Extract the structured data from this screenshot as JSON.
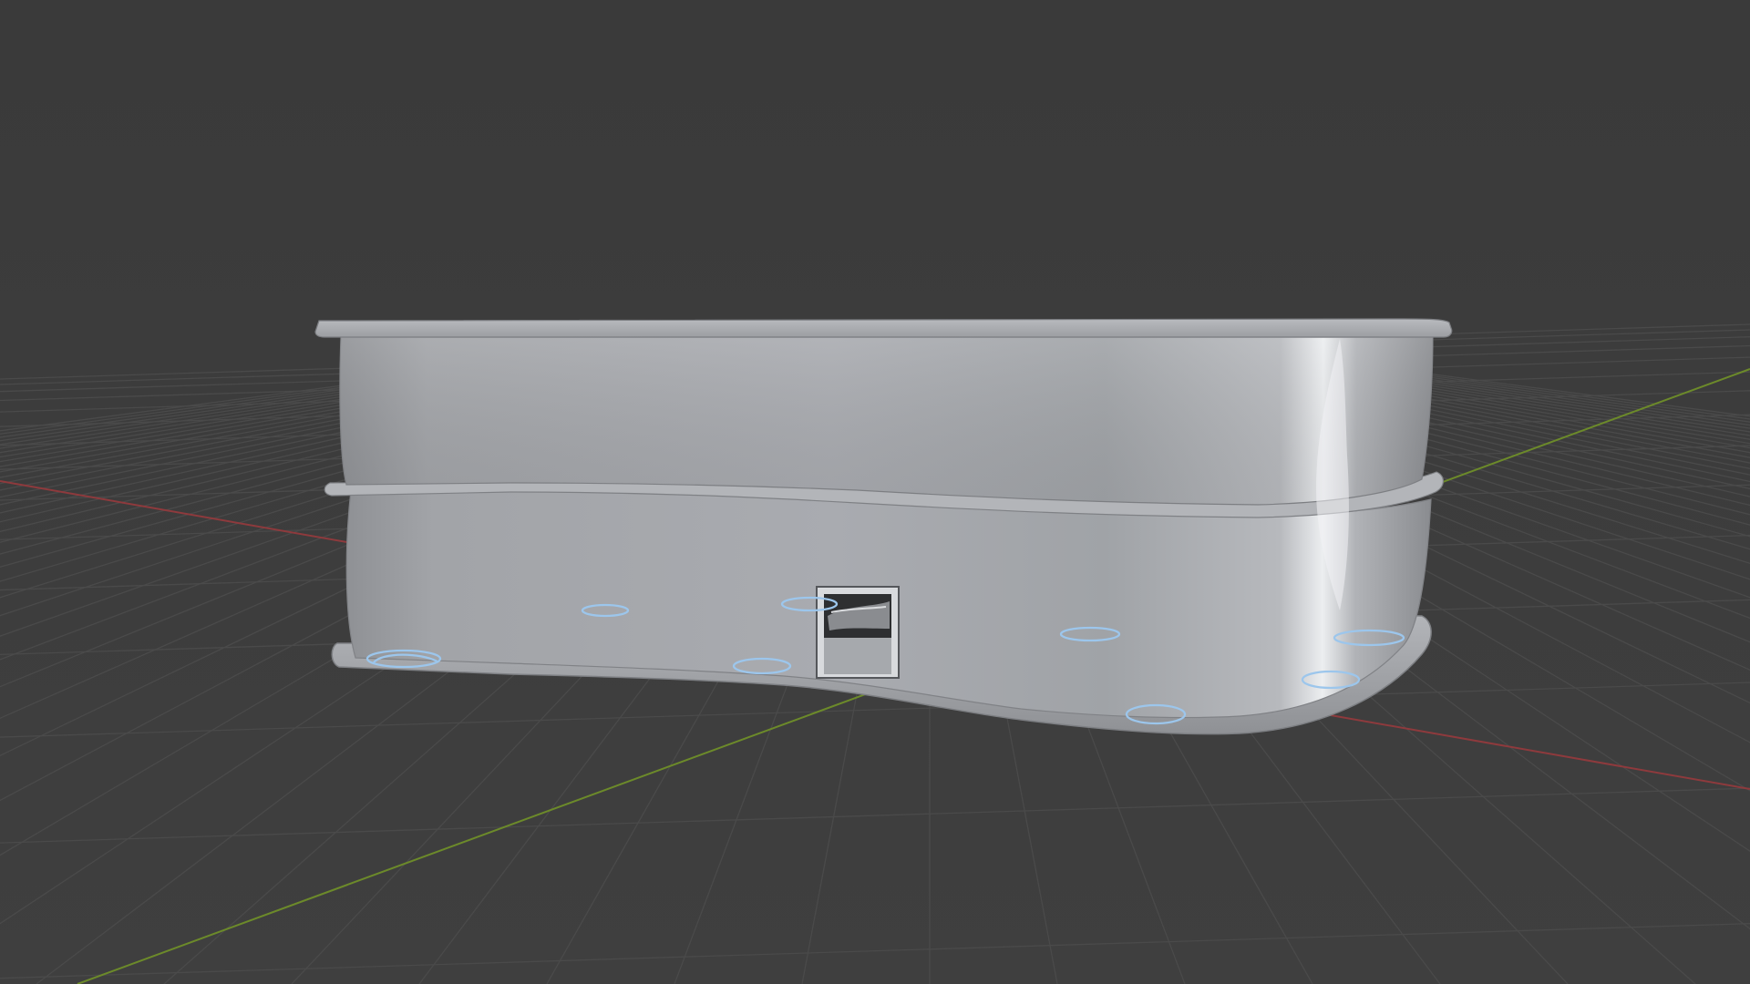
{
  "viewport": {
    "background_color": "#3d3d3d",
    "grid_line_color": "#4a4a4a",
    "x_axis_color": "#8e3a3d",
    "y_axis_color": "#6c8a2a"
  },
  "model": {
    "object": "enclosure-body",
    "body_color": "#a5a8ad",
    "selection_outline_color": "#9cc6ec",
    "outlined_feature_count": 9,
    "port_cutout_count": 1
  }
}
